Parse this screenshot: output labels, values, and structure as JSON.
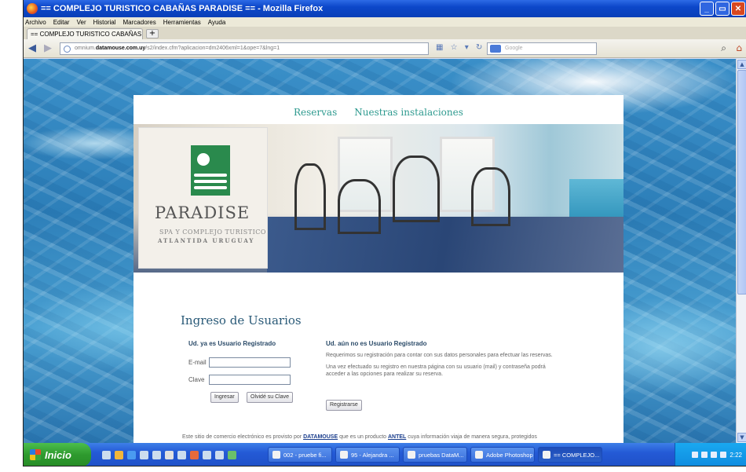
{
  "window": {
    "title": "== COMPLEJO TURISTICO CABAÑAS PARADISE == - Mozilla Firefox",
    "buttons": [
      "_",
      "▭",
      "✕"
    ]
  },
  "menu": [
    "Archivo",
    "Editar",
    "Ver",
    "Historial",
    "Marcadores",
    "Herramientas",
    "Ayuda"
  ],
  "tab": {
    "label": "== COMPLEJO TURISTICO CABAÑAS PARA...",
    "new_tab": "+"
  },
  "nav": {
    "url_prefix": "omnium.",
    "url_domain": "datamouse.com.uy",
    "url_rest": "/s2/index.cfm?aplicacion=dm2406xml=1&ope=7&lng=1",
    "search_placeholder": "Google"
  },
  "site": {
    "nav_links": [
      "Reservas",
      "Nuestras instalaciones"
    ],
    "logo": {
      "title": "PARADISE",
      "subtitle1": "SPA Y COMPLEJO TURISTICO",
      "subtitle2": "ATLANTIDA URUGUAY"
    },
    "login_title": "Ingreso de Usuarios",
    "registered": {
      "heading": "Ud. ya es Usuario Registrado",
      "email_label": "E-mail",
      "email_value": "",
      "password_label": "Clave",
      "password_value": "",
      "login_button": "Ingresar",
      "forgot_button": "Olvidé su Clave"
    },
    "unregistered": {
      "heading": "Ud. aún no es Usuario Registrado",
      "para1": "Requerimos su registración para contar con sus datos personales para efectuar las reservas.",
      "para2": "Una vez efectuado su registro en nuestra página con su usuario (mail) y contraseña podrá acceder a las opciones para realizar su reserva.",
      "register_button": "Registrarse"
    },
    "footer": {
      "text1": "Este sitio de comercio electrónico es provisto por ",
      "link1": "DATAMOUSE",
      "text2": " que es un producto ",
      "link2": "ANTEL",
      "text3": " cuya información viaja de manera segura, protegidos"
    }
  },
  "taskbar": {
    "start": "Inicio",
    "tasks": [
      "002 - pruebe fi...",
      "95 - Alejandra ...",
      "pruebas DataM...",
      "Adobe Photoshop",
      "== COMPLEJO..."
    ],
    "clock": "2:22"
  }
}
